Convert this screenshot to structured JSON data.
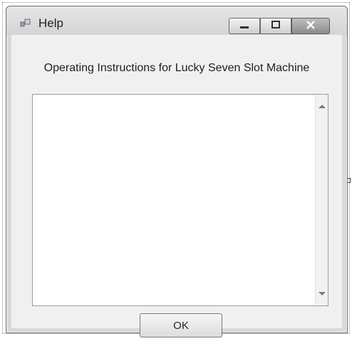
{
  "window": {
    "title": "Help",
    "icon": "form-icon",
    "controls": {
      "minimize": "minimize-icon",
      "maximize": "maximize-icon",
      "close": "close-icon"
    }
  },
  "content": {
    "heading": "Operating Instructions for Lucky Seven Slot Machine",
    "textbox_value": "",
    "ok_label": "OK"
  }
}
